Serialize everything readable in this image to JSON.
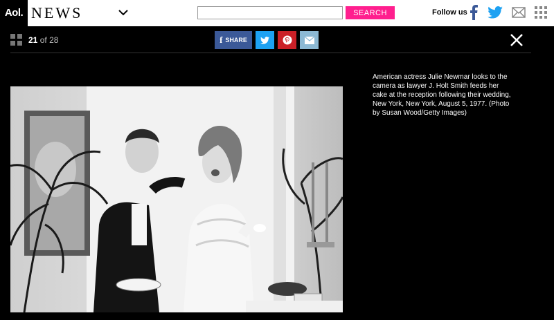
{
  "header": {
    "logo": "Aol.",
    "section": "NEWS",
    "search": {
      "placeholder": "",
      "button_label": "SEARCH"
    },
    "follow_label": "Follow us",
    "social_icons": [
      "facebook-icon",
      "twitter-icon",
      "mail-icon",
      "apps-grid-icon"
    ],
    "colors": {
      "search_button": "#ff1f8e",
      "facebook": "#3b5998",
      "twitter": "#1da1f2"
    }
  },
  "slideshow": {
    "current": "21",
    "of_label": "of",
    "total": "28",
    "share": {
      "facebook_label": "SHARE",
      "buttons": [
        "facebook-share",
        "twitter-share",
        "pinterest-share",
        "email-share"
      ],
      "colors": {
        "facebook": "#3b5998",
        "twitter": "#1da1f2",
        "pinterest": "#cb2027",
        "email": "#8cb9d4"
      }
    },
    "caption": "American actress Julie Newmar looks to the camera as lawyer J. Holt Smith feeds her cake at the reception following their wedding, New York, New York, August 5, 1977. (Photo by Susan Wood/Getty Images)"
  }
}
